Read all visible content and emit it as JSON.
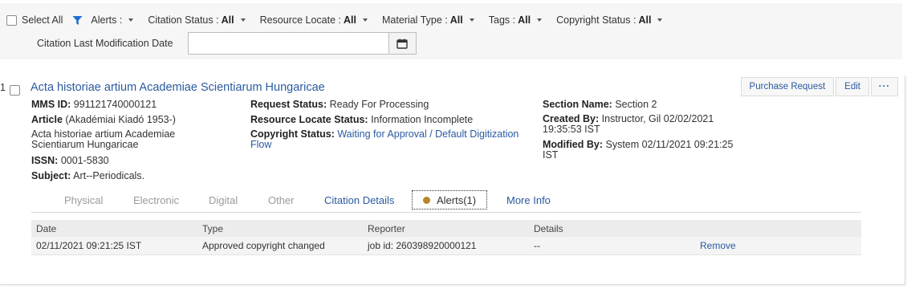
{
  "filters": {
    "select_all": "Select All",
    "alerts_label": "Alerts :",
    "citation_status_label": "Citation Status :",
    "citation_status_value": "All",
    "resource_locate_label": "Resource Locate :",
    "resource_locate_value": "All",
    "material_type_label": "Material Type :",
    "material_type_value": "All",
    "tags_label": "Tags :",
    "tags_value": "All",
    "copyright_status_label": "Copyright Status :",
    "copyright_status_value": "All",
    "date_label": "Citation Last Modification Date",
    "date_value": ""
  },
  "citation": {
    "row_number": "1",
    "title": "Acta historiae artium Academiae Scientiarum Hungaricae",
    "actions": {
      "purchase_request": "Purchase Request",
      "edit": "Edit",
      "more": "···"
    },
    "col1": {
      "mms_label": "MMS ID:",
      "mms_value": "991121740000121",
      "article_label": "Article",
      "article_value": "(Akadémiai Kiadó 1953-)",
      "description": "Acta historiae artium Academiae Scientiarum Hungaricae",
      "issn_label": "ISSN:",
      "issn_value": "0001-5830",
      "subject_label": "Subject:",
      "subject_value": "Art--Periodicals."
    },
    "col2": {
      "request_status_label": "Request Status:",
      "request_status_value": "Ready For Processing",
      "resource_locate_label": "Resource Locate Status:",
      "resource_locate_value": "Information Incomplete",
      "copyright_label": "Copyright Status:",
      "copyright_value": "Waiting for Approval / Default Digitization Flow"
    },
    "col3": {
      "section_label": "Section Name:",
      "section_value": "Section 2",
      "created_label": "Created By:",
      "created_value": "Instructor, Gil 02/02/2021 19:35:53 IST",
      "modified_label": "Modified By:",
      "modified_value": "System 02/11/2021 09:21:25 IST"
    }
  },
  "tabs": {
    "physical": "Physical",
    "electronic": "Electronic",
    "digital": "Digital",
    "other": "Other",
    "citation_details": "Citation Details",
    "alerts": "Alerts(1)",
    "more_info": "More Info"
  },
  "alerts_table": {
    "headers": {
      "date": "Date",
      "type": "Type",
      "reporter": "Reporter",
      "details": "Details"
    },
    "rows": [
      {
        "date": "02/11/2021 09:21:25 IST",
        "type": "Approved copyright changed",
        "reporter": "job id: 260398920000121",
        "details": "--",
        "action": "Remove"
      }
    ]
  },
  "colors": {
    "link": "#2b5aa0",
    "alert_dot": "#b8872c",
    "filter_icon": "#1f6fd1"
  }
}
